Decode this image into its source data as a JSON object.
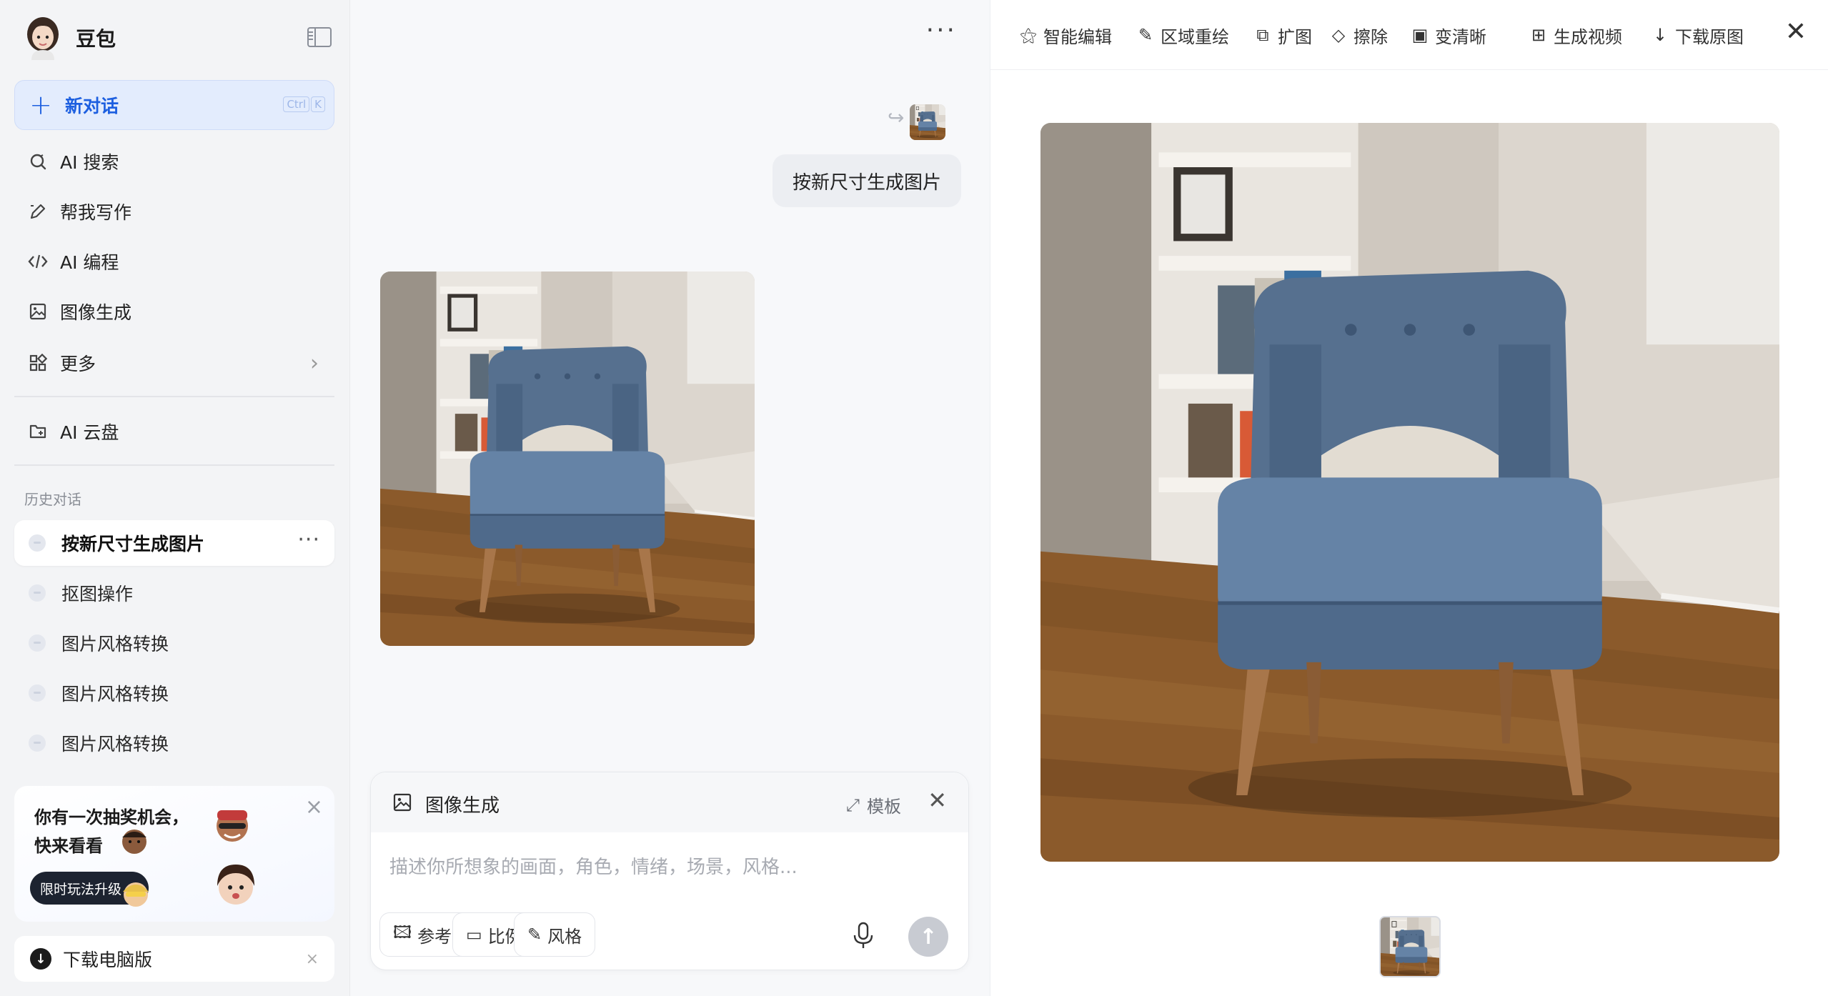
{
  "sidebar": {
    "app_name": "豆包",
    "new_chat": {
      "label": "新对话",
      "shortcut": [
        "Ctrl",
        "K"
      ]
    },
    "nav": [
      {
        "label": "AI 搜索",
        "icon": "search-icon"
      },
      {
        "label": "帮我写作",
        "icon": "pen-icon"
      },
      {
        "label": "AI 编程",
        "icon": "code-icon"
      },
      {
        "label": "图像生成",
        "icon": "image-icon"
      },
      {
        "label": "更多",
        "icon": "grid-icon"
      }
    ],
    "cloud": {
      "label": "AI 云盘",
      "icon": "cloud-drive-icon"
    },
    "history_title": "历史对话",
    "history": [
      {
        "label": "按新尺寸生成图片",
        "active": true
      },
      {
        "label": "抠图操作"
      },
      {
        "label": "图片风格转换"
      },
      {
        "label": "图片风格转换"
      },
      {
        "label": "图片风格转换"
      }
    ],
    "promo": {
      "text": "你有一次抽奖机会，快来看看",
      "button": "限时玩法升级"
    },
    "download": {
      "label": "下载电脑版"
    }
  },
  "chat": {
    "user_message": "按新尺寸生成图片",
    "composer": {
      "mode_title": "图像生成",
      "template_label": "模板",
      "placeholder": "描述你所想象的画面，角色，情绪，场景，风格...",
      "chips": [
        "参考图",
        "比例",
        "风格"
      ]
    }
  },
  "preview": {
    "tools": [
      {
        "label": "智能编辑",
        "icon": "magic-wand-icon"
      },
      {
        "label": "区域重绘",
        "icon": "brush-icon"
      },
      {
        "label": "扩图",
        "icon": "expand-icon"
      },
      {
        "label": "擦除",
        "icon": "eraser-icon"
      },
      {
        "label": "变清晰",
        "icon": "hd-icon"
      },
      {
        "label": "生成视频",
        "icon": "video-icon"
      },
      {
        "label": "下载原图",
        "icon": "download-icon"
      }
    ]
  },
  "colors": {
    "accent": "#1d5fe0",
    "sidebar_bg": "#f3f4f6",
    "chair_blue": "#5a7596",
    "floor": "#8a5a2a"
  }
}
